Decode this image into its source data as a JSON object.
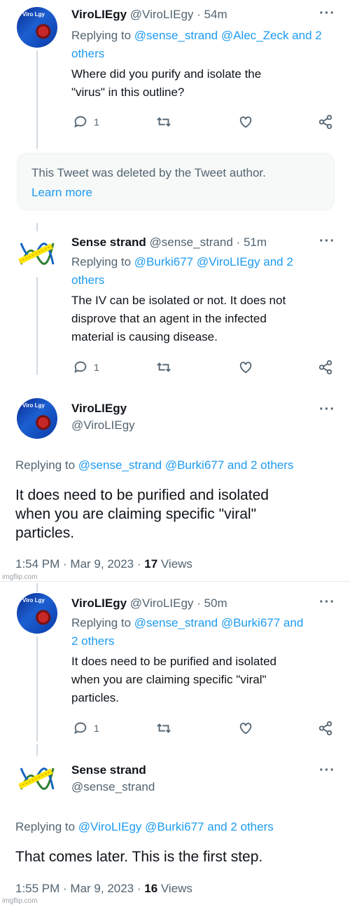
{
  "tweet1": {
    "name": "ViroLIEgy",
    "handle": "@ViroLIEgy",
    "time": "· 54m",
    "reply_prefix": "Replying to ",
    "reply_links": "@sense_strand @Alec_Zeck and 2 others",
    "text_lines": [
      "Where did you purify and isolate the",
      "\"virus\" in this outline?"
    ],
    "reply_count": "1"
  },
  "deleted": {
    "text": "This Tweet was deleted by the Tweet author.",
    "link": "Learn more"
  },
  "tweet2": {
    "name": "Sense strand",
    "handle": "@sense_strand",
    "time": "· 51m",
    "reply_prefix": "Replying to ",
    "reply_links_line1": "@Burki677 @ViroLIEgy and 2",
    "reply_links_line2": "others",
    "text_lines": [
      "The IV can be isolated or not. It does not",
      "disprove that an agent in the infected",
      "material is causing disease."
    ],
    "reply_count": "1"
  },
  "tweet3": {
    "name": "ViroLIEgy",
    "handle": "@ViroLIEgy",
    "reply_prefix": "Replying to ",
    "reply_links": "@sense_strand @Burki677 and 2 others",
    "text_lines": [
      "It does need to be purified and isolated",
      "when you are claiming specific \"viral\"",
      "particles."
    ],
    "timestamp": "1:54 PM · Mar 9, 2023 · ",
    "views_count": "17",
    "views_label": " Views"
  },
  "tweet4": {
    "name": "ViroLIEgy",
    "handle": "@ViroLIEgy",
    "time": "· 50m",
    "reply_prefix": "Replying to ",
    "reply_links_line1": "@sense_strand @Burki677 and",
    "reply_links_line2": "2 others",
    "text_lines": [
      "It does need to be purified and isolated",
      "when you are claiming specific \"viral\"",
      "particles."
    ],
    "reply_count": "1"
  },
  "tweet5": {
    "name": "Sense strand",
    "handle": "@sense_strand",
    "reply_prefix": "Replying to ",
    "reply_links": "@ViroLIEgy @Burki677 and 2 others",
    "text": "That comes later. This is the first step.",
    "timestamp": "1:55 PM · Mar 9, 2023 · ",
    "views_count": "16",
    "views_label": " Views"
  },
  "watermark": "imgflip.com",
  "avatar_logo": "Viro Lgy",
  "icons": {
    "more": "more-dots-icon",
    "reply": "reply-bubble-icon",
    "retweet": "retweet-icon",
    "like": "heart-icon",
    "share": "share-icon"
  },
  "colors": {
    "link": "#1d9bf0",
    "secondary": "#536471",
    "text": "#0f1419",
    "thread_line": "#cfd9de"
  }
}
